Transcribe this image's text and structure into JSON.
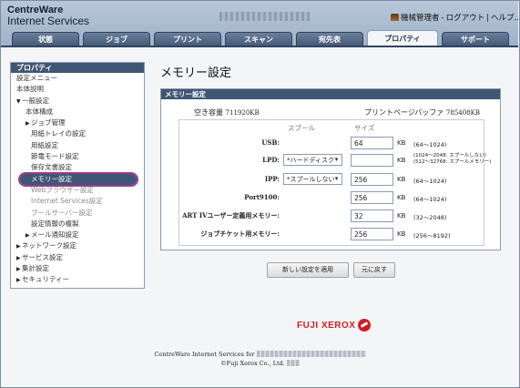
{
  "header": {
    "brand_line1": "CentreWare",
    "brand_line2": "Internet Services",
    "user_label": "機械管理者",
    "logout": "ログアウト",
    "help": "ヘルプ..."
  },
  "tabs": [
    {
      "label": "状態"
    },
    {
      "label": "ジョブ"
    },
    {
      "label": "プリント"
    },
    {
      "label": "スキャン"
    },
    {
      "label": "宛先表"
    },
    {
      "label": "プロパティ",
      "active": true
    },
    {
      "label": "サポート"
    }
  ],
  "sidebar": {
    "title": "プロパティ",
    "items": [
      {
        "label": "設定メニュー"
      },
      {
        "label": "本体説明"
      },
      {
        "label": "一般設定"
      },
      {
        "label": "本体構成"
      },
      {
        "label": "ジョブ管理"
      },
      {
        "label": "用紙トレイの設定"
      },
      {
        "label": "用紙設定"
      },
      {
        "label": "節電モード設定"
      },
      {
        "label": "保存文書設定"
      },
      {
        "label": "メモリー設定"
      },
      {
        "label": "Webブラウザー設定"
      },
      {
        "label": "Internet Services設定"
      },
      {
        "label": "プールサーバー設定"
      },
      {
        "label": "設定情報の複製"
      },
      {
        "label": "メール通知設定"
      },
      {
        "label": "ネットワーク設定"
      },
      {
        "label": "サービス設定"
      },
      {
        "label": "集計設定"
      },
      {
        "label": "セキュリティー"
      }
    ]
  },
  "main": {
    "title": "メモリー設定",
    "panel_title": "メモリー設定",
    "free_capacity_label": "空き容量",
    "free_capacity_value": "711920KB",
    "print_page_buffer_label": "プリントページバッファ",
    "print_page_buffer_value": "785408KB",
    "col_spool": "スプール",
    "col_size": "サイズ",
    "rows": [
      {
        "label": "USB:",
        "select": "",
        "value": "64",
        "unit": "KB",
        "range": "(64〜1024)"
      },
      {
        "label": "LPD:",
        "select": "*ハードディスク",
        "value": "",
        "unit": "KB",
        "range": "(1024〜2048: スプールしない)",
        "range2": "(512〜32768: スプールメモリー)"
      },
      {
        "label": "IPP:",
        "select": "*スプールしない",
        "value": "256",
        "unit": "KB",
        "range": "(64〜1024)"
      },
      {
        "label": "Port9100:",
        "select": "",
        "value": "256",
        "unit": "KB",
        "range": "(64〜1024)"
      },
      {
        "label": "ART IVユーザー定義用メモリー:",
        "select": "",
        "value": "32",
        "unit": "KB",
        "range": "(32〜2048)"
      },
      {
        "label": "ジョブチケット用メモリー:",
        "select": "",
        "value": "256",
        "unit": "KB",
        "range": "(256〜8192)"
      }
    ],
    "apply_button": "新しい設定を適用",
    "undo_button": "元に戻す"
  },
  "footer": {
    "logo": "FUJI XEROX",
    "line1": "CentreWare Internet Services for",
    "line2": "©Fuji Xerox Co., Ltd."
  }
}
